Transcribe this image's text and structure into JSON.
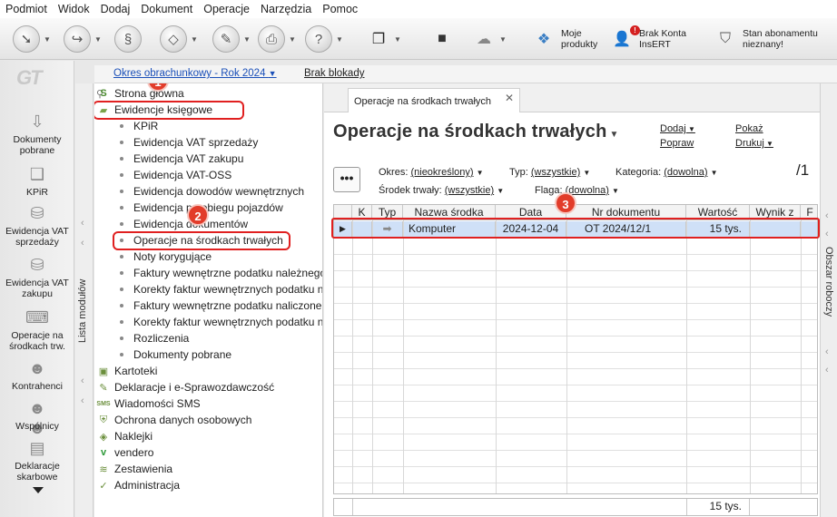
{
  "menu": [
    "Podmiot",
    "Widok",
    "Dodaj",
    "Dokument",
    "Operacje",
    "Narzędzia",
    "Pomoc"
  ],
  "toolbar": {
    "moje_produkty": "Moje\nprodukty",
    "brak_konta": "Brak Konta\nInsERT",
    "stan_abonamentu": "Stan abonamentu\nnieznany!",
    "badge": "!"
  },
  "leftbar": {
    "logo": "GT",
    "items": [
      "Dokumenty pobrane",
      "KPiR",
      "Ewidencja VAT sprzedaży",
      "Ewidencja VAT zakupu",
      "Operacje na środkach trw.",
      "Kontrahenci",
      "Wspólnicy",
      "Deklaracje skarbowe"
    ],
    "vertical_label": "Lista modułów"
  },
  "subheader": {
    "okres": "Okres obrachunkowy - Rok 2024",
    "brak_blokady": "Brak blokady"
  },
  "tree": {
    "top": [
      {
        "label": "Strona główna",
        "icon": "s-icon"
      },
      {
        "label": "Ewidencje księgowe",
        "icon": "book-icon"
      }
    ],
    "children": [
      "KPiR",
      "Ewidencja VAT sprzedaży",
      "Ewidencja VAT zakupu",
      "Ewidencja VAT-OSS",
      "Ewidencja dowodów wewnętrznych",
      "Ewidencja przebiegu pojazdów",
      "Ewidencja dokumentów",
      "Operacje na środkach trwałych",
      "Noty korygujące",
      "Faktury wewnętrzne podatku należnego",
      "Korekty faktur wewnętrznych podatku należnego",
      "Faktury wewnętrzne podatku naliczonego",
      "Korekty faktur wewnętrznych podatku naliczonego",
      "Rozliczenia",
      "Dokumenty pobrane"
    ],
    "bottom": [
      {
        "label": "Kartoteki",
        "icon": "folder-icon"
      },
      {
        "label": "Deklaracje i e-Sprawozdawczość",
        "icon": "declaration-icon"
      },
      {
        "label": "Wiadomości SMS",
        "icon": "sms-icon"
      },
      {
        "label": "Ochrona danych osobowych",
        "icon": "shield-icon"
      },
      {
        "label": "Naklejki",
        "icon": "label-icon"
      },
      {
        "label": "vendero",
        "icon": "vendero-icon"
      },
      {
        "label": "Zestawienia",
        "icon": "report-icon"
      },
      {
        "label": "Administracja",
        "icon": "admin-icon"
      }
    ]
  },
  "callouts": [
    "1",
    "2",
    "3"
  ],
  "main": {
    "tab_label": "Operacje na środkach trwałych",
    "title": "Operacje na środkach trwałych",
    "actions": {
      "dodaj": "Dodaj",
      "pokaz": "Pokaż",
      "popraw": "Popraw",
      "drukuj": "Drukuj"
    },
    "more_button": "•••",
    "filters": {
      "okres_label": "Okres:",
      "okres_value": "(nieokreślony)",
      "typ_label": "Typ:",
      "typ_value": "(wszystkie)",
      "kategoria_label": "Kategoria:",
      "kategoria_value": "(dowolna)",
      "srodek_label": "Środek trwały:",
      "srodek_value": "(wszystkie)",
      "flaga_label": "Flaga:",
      "flaga_value": "(dowolna)"
    },
    "count": "/1",
    "columns": [
      "",
      "K",
      "Typ",
      "Nazwa środka",
      "Data",
      "Nr dokumentu",
      "Wartość",
      "Wynik z",
      "F"
    ],
    "rows": [
      {
        "k": "",
        "typ": "arrow-right-icon",
        "nazwa": "Komputer",
        "data": "2024-12-04",
        "nr": "OT 2024/12/1",
        "wartosc": "15 tys.",
        "wynik": "",
        "f": ""
      }
    ],
    "footer_total": "15 tys."
  },
  "rightbar": {
    "vertical_label": "Obszar roboczy"
  }
}
